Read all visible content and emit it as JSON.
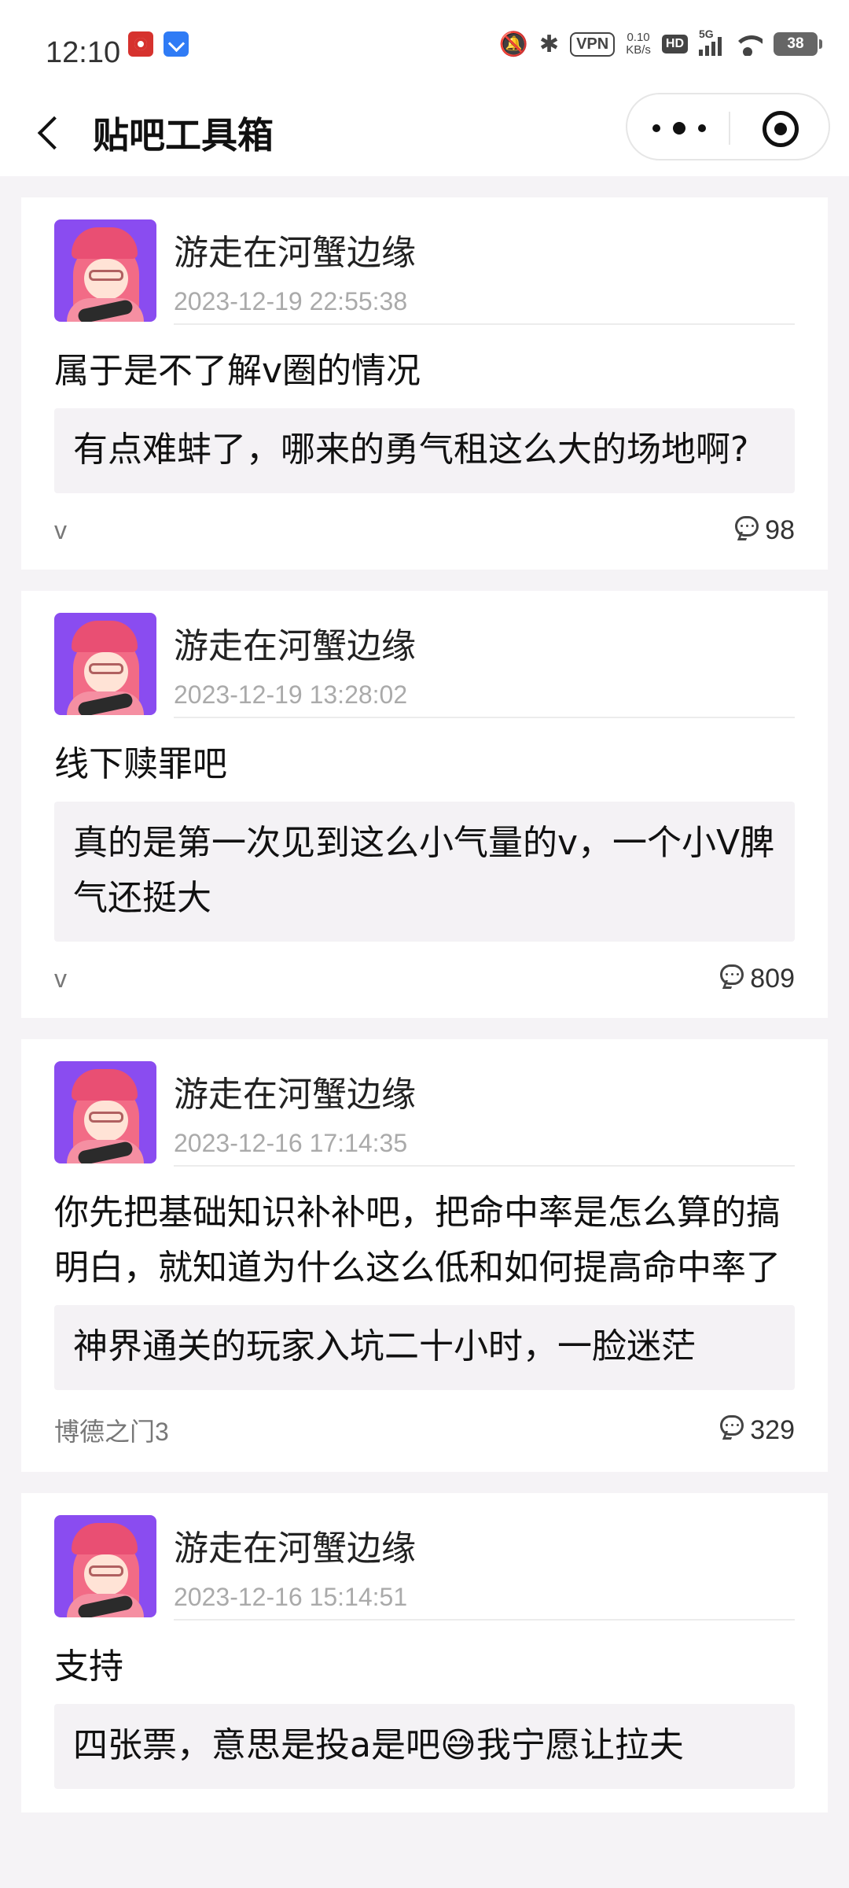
{
  "status_bar": {
    "time": "12:10",
    "vpn": "VPN",
    "speed_value": "0.10",
    "speed_unit": "KB/s",
    "hd": "HD",
    "network": "5G",
    "battery": "38"
  },
  "nav": {
    "title": "贴吧工具箱"
  },
  "posts": [
    {
      "author": "游走在河蟹边缘",
      "time": "2023-12-19 22:55:38",
      "title": "属于是不了解v圈的情况",
      "quote": "有点难蚌了，哪来的勇气租这么大的场地啊?",
      "forum": "v",
      "replies": "98"
    },
    {
      "author": "游走在河蟹边缘",
      "time": "2023-12-19 13:28:02",
      "title": "线下赎罪吧",
      "quote": "真的是第一次见到这么小气量的v，一个小V脾气还挺大",
      "forum": "v",
      "replies": "809"
    },
    {
      "author": "游走在河蟹边缘",
      "time": "2023-12-16 17:14:35",
      "title": "你先把基础知识补补吧，把命中率是怎么算的搞明白，就知道为什么这么低和如何提高命中率了",
      "quote": "神界通关的玩家入坑二十小时，一脸迷茫",
      "forum": "博德之门3",
      "replies": "329"
    },
    {
      "author": "游走在河蟹边缘",
      "time": "2023-12-16 15:14:51",
      "title": "支持",
      "quote": "四张票，意思是投a是吧😅我宁愿让拉夫",
      "forum": "",
      "replies": ""
    }
  ]
}
